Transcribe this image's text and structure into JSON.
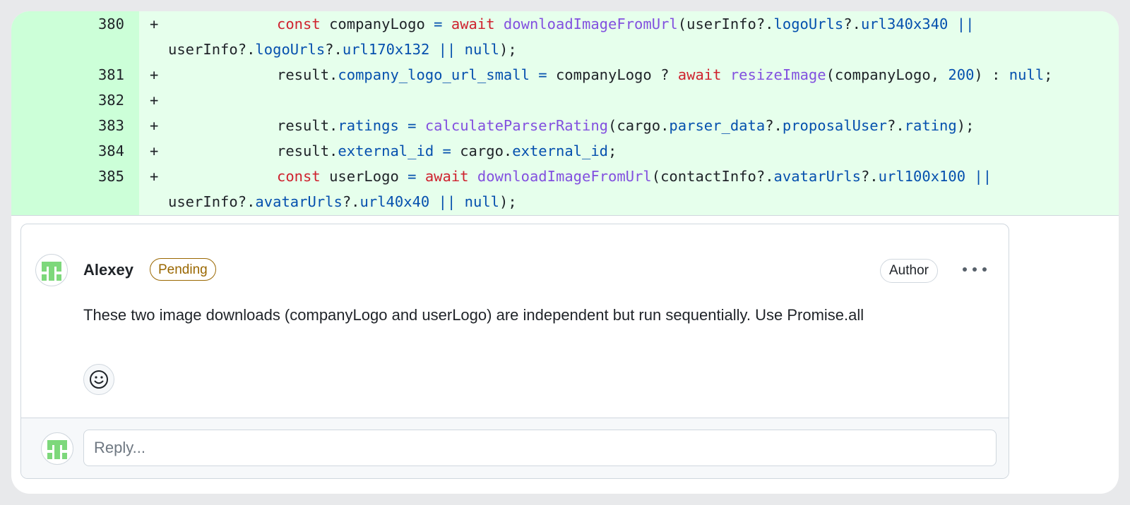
{
  "diff": {
    "lines": [
      {
        "number": "380",
        "marker": "+",
        "tokens": [
          {
            "t": "const ",
            "c": "kw"
          },
          {
            "t": "companyLogo ",
            "c": ""
          },
          {
            "t": "= ",
            "c": "pr"
          },
          {
            "t": "await ",
            "c": "kw"
          },
          {
            "t": "downloadImageFromUrl",
            "c": "fn"
          },
          {
            "t": "(userInfo?.",
            "c": ""
          },
          {
            "t": "logoUrls",
            "c": "pr"
          },
          {
            "t": "?.",
            "c": ""
          },
          {
            "t": "url340x340 ||",
            "c": "pr"
          }
        ],
        "continuation": [
          {
            "t": "userInfo?.",
            "c": ""
          },
          {
            "t": "logoUrls",
            "c": "pr"
          },
          {
            "t": "?.",
            "c": ""
          },
          {
            "t": "url170x132 || null",
            "c": "pr"
          },
          {
            "t": ");",
            "c": ""
          }
        ]
      },
      {
        "number": "381",
        "marker": "+",
        "tokens": [
          {
            "t": "result.",
            "c": ""
          },
          {
            "t": "company_logo_url_small = ",
            "c": "pr"
          },
          {
            "t": "companyLogo ? ",
            "c": ""
          },
          {
            "t": "await ",
            "c": "kw"
          },
          {
            "t": "resizeImage",
            "c": "fn"
          },
          {
            "t": "(companyLogo, ",
            "c": ""
          },
          {
            "t": "200",
            "c": "pr"
          },
          {
            "t": ") : ",
            "c": ""
          },
          {
            "t": "null",
            "c": "pr"
          },
          {
            "t": ";",
            "c": ""
          }
        ]
      },
      {
        "number": "382",
        "marker": "+",
        "tokens": []
      },
      {
        "number": "383",
        "marker": "+",
        "tokens": [
          {
            "t": "result.",
            "c": ""
          },
          {
            "t": "ratings = ",
            "c": "pr"
          },
          {
            "t": "calculateParserRating",
            "c": "fn"
          },
          {
            "t": "(cargo.",
            "c": ""
          },
          {
            "t": "parser_data",
            "c": "pr"
          },
          {
            "t": "?.",
            "c": ""
          },
          {
            "t": "proposalUser",
            "c": "pr"
          },
          {
            "t": "?.",
            "c": ""
          },
          {
            "t": "rating",
            "c": "pr"
          },
          {
            "t": ");",
            "c": ""
          }
        ]
      },
      {
        "number": "384",
        "marker": "+",
        "tokens": [
          {
            "t": "result.",
            "c": ""
          },
          {
            "t": "external_id = ",
            "c": "pr"
          },
          {
            "t": "cargo.",
            "c": ""
          },
          {
            "t": "external_id",
            "c": "pr"
          },
          {
            "t": ";",
            "c": ""
          }
        ]
      },
      {
        "number": "385",
        "marker": "+",
        "tokens": [
          {
            "t": "const ",
            "c": "kw"
          },
          {
            "t": "userLogo ",
            "c": ""
          },
          {
            "t": "= ",
            "c": "pr"
          },
          {
            "t": "await ",
            "c": "kw"
          },
          {
            "t": "downloadImageFromUrl",
            "c": "fn"
          },
          {
            "t": "(contactInfo?.",
            "c": ""
          },
          {
            "t": "avatarUrls",
            "c": "pr"
          },
          {
            "t": "?.",
            "c": ""
          },
          {
            "t": "url100x100 ||",
            "c": "pr"
          }
        ],
        "continuation": [
          {
            "t": "userInfo?.",
            "c": ""
          },
          {
            "t": "avatarUrls",
            "c": "pr"
          },
          {
            "t": "?.",
            "c": ""
          },
          {
            "t": "url40x40 || null",
            "c": "pr"
          },
          {
            "t": ");",
            "c": ""
          }
        ]
      }
    ]
  },
  "comment": {
    "author": "Alexey",
    "status_badge": "Pending",
    "role_badge": "Author",
    "body": "These two image downloads (companyLogo and userLogo) are independent but run sequentially. Use Promise.all",
    "avatar_icon": "identicon-avatar",
    "more_icon": "kebab-horizontal-icon",
    "reaction_icon": "smiley-icon"
  },
  "reply": {
    "placeholder": "Reply..."
  },
  "colors": {
    "added_line_bg": "#e6ffec",
    "added_gutter_bg": "#ccffd8",
    "keyword": "#cf222e",
    "function": "#8250df",
    "property": "#0550ae",
    "pending": "#9a6700",
    "identicon": "#7dd87b"
  }
}
